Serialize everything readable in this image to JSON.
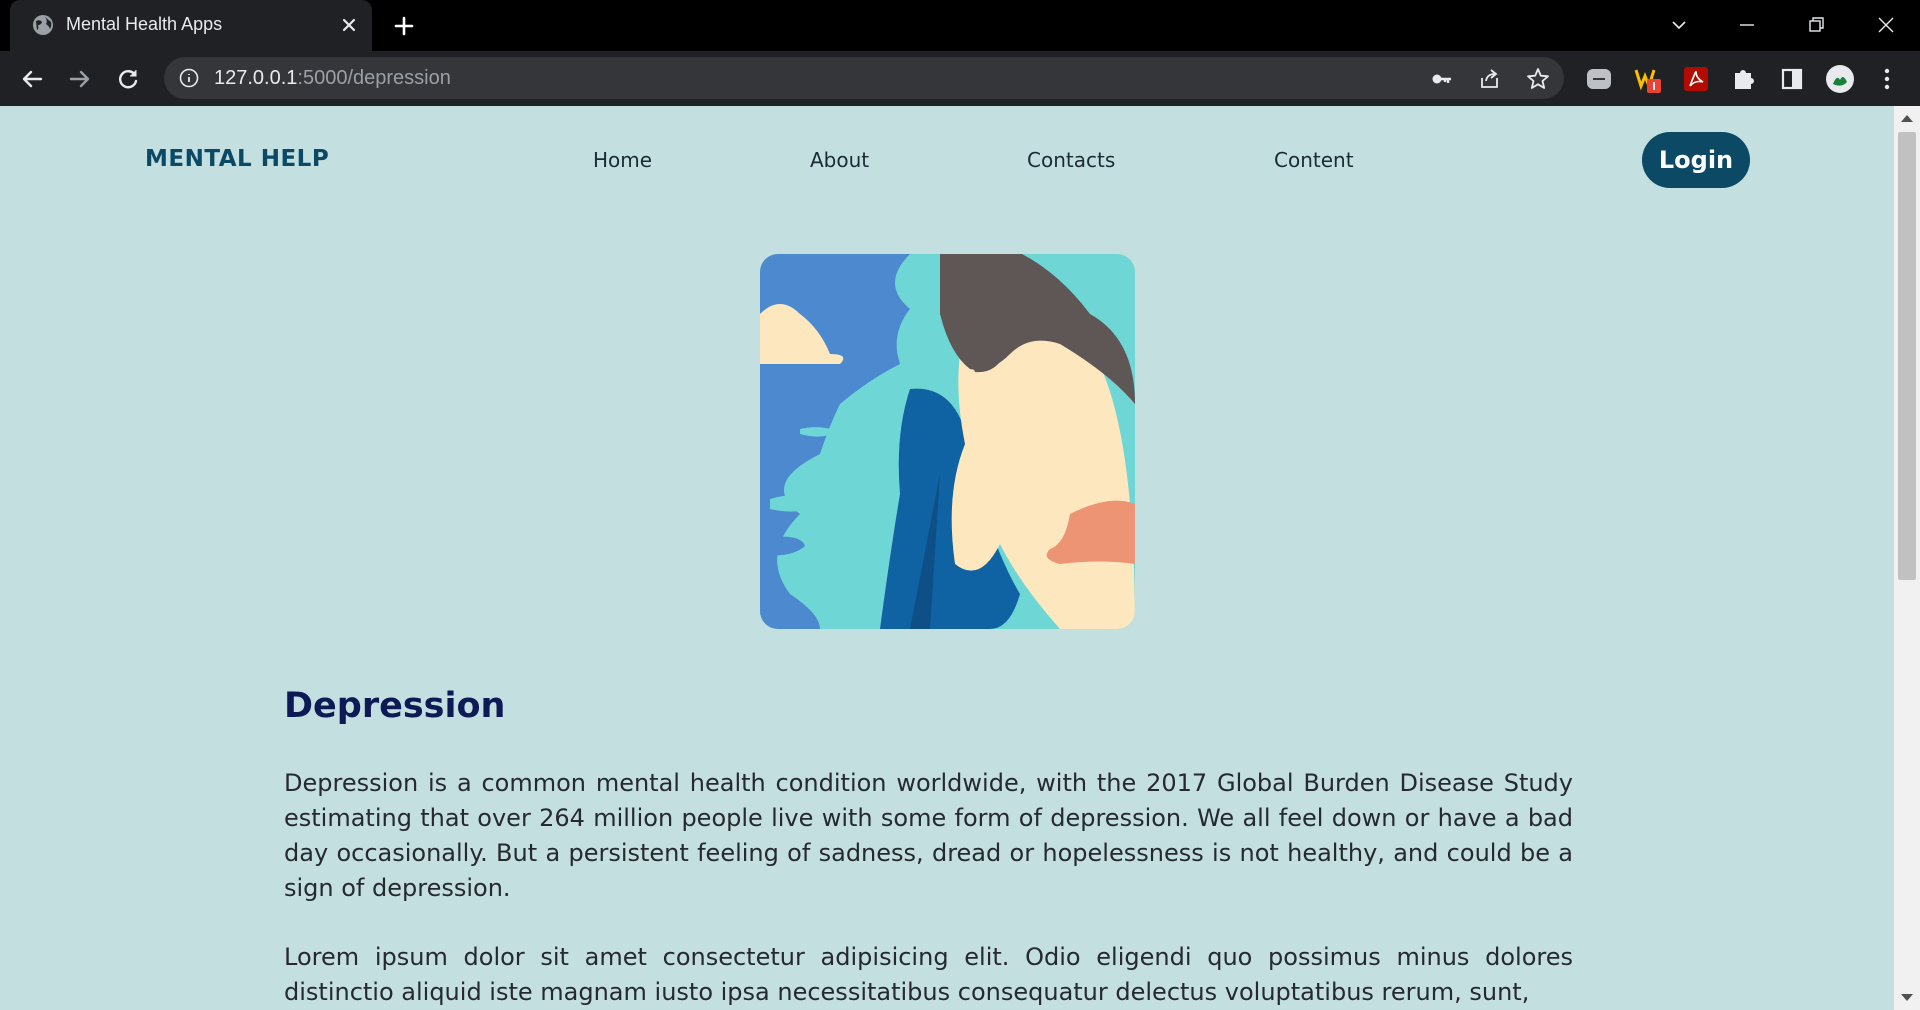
{
  "browser": {
    "tab_title": "Mental Health Apps",
    "url_host": "127.0.0.1",
    "url_path": ":5000/depression"
  },
  "navbar": {
    "brand": "MENTAL HELP",
    "links": [
      "Home",
      "About",
      "Contacts",
      "Content"
    ],
    "login_label": "Login"
  },
  "article": {
    "title": "Depression",
    "paragraphs": [
      "Depression is a common mental health condition worldwide, with the 2017 Global Burden Disease Study estimating that over 264 million people live with some form of depression. We all feel down or have a bad day occasionally. But a persistent feeling of sadness, dread or hopelessness is not healthy, and could be a sign of depression.",
      "Lorem ipsum dolor sit amet consectetur adipisicing elit. Odio eligendi quo possimus minus dolores distinctio aliquid iste magnam iusto ipsa necessitatibus consequatur delectus voluptatibus rerum, sunt,"
    ]
  },
  "colors": {
    "page_bg": "#c3dfe0",
    "brand": "#0b4965",
    "heading": "#0e1a55"
  },
  "icons": [
    "globe-icon",
    "close-icon",
    "plus-icon",
    "back-icon",
    "forward-icon",
    "reload-icon",
    "info-icon",
    "key-icon",
    "share-icon",
    "star-icon",
    "puzzle-icon",
    "sidebar-icon",
    "avatar",
    "menu-dots-icon"
  ]
}
